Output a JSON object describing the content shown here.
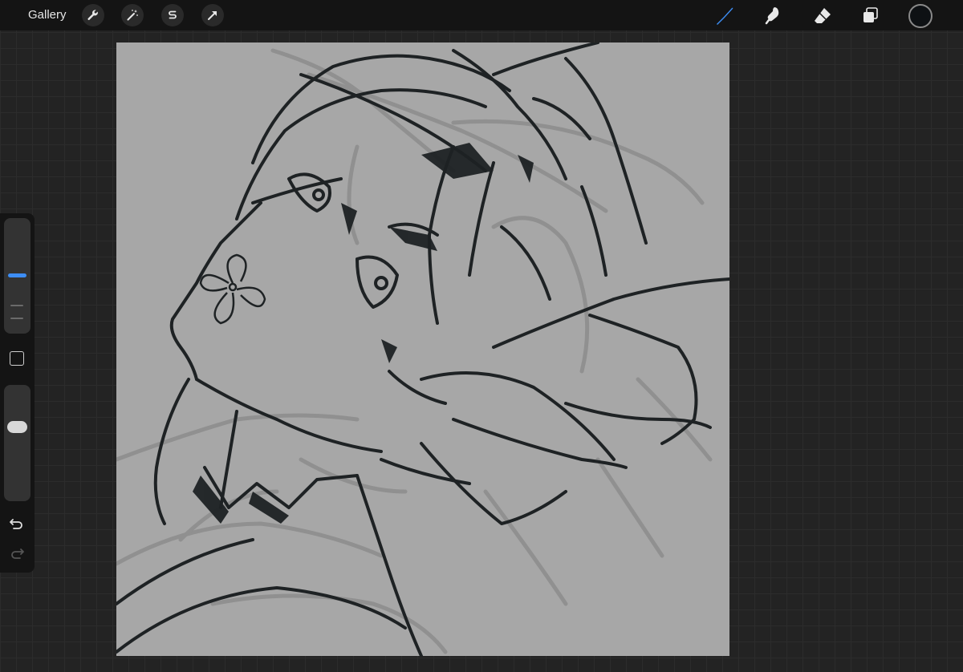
{
  "topbar": {
    "gallery_label": "Gallery",
    "left_tools": [
      "wrench-icon",
      "magic-wand-icon",
      "selection-s-icon",
      "transform-arrow-icon"
    ],
    "right_tools": [
      "brush-icon",
      "smudge-icon",
      "eraser-icon",
      "layers-icon"
    ],
    "active_tool": "brush-icon",
    "current_color": "#0e1114",
    "accent_color": "#3d8ef5"
  },
  "sidebar": {
    "brush_size_slider": "size",
    "opacity_slider": "opacity",
    "modify_button_icon": "square-icon",
    "undo_icon": "undo-icon",
    "redo_icon": "redo-icon"
  },
  "canvas": {
    "background_color": "#a7a7a7",
    "content": "sketch"
  }
}
